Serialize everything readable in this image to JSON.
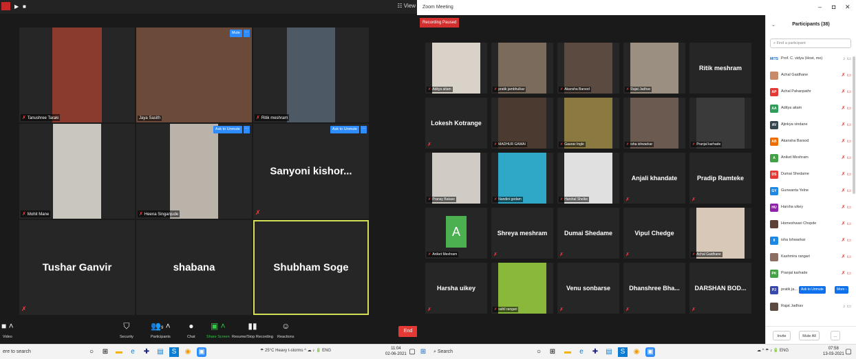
{
  "left_window": {
    "view_label": "View",
    "tiles": [
      {
        "name": "Tanushree Taraki",
        "kind": "video",
        "color": "#8a3b2e",
        "muted": true
      },
      {
        "name": "Jaya Sasith",
        "kind": "video",
        "color": "#6b4a3a",
        "muted": false,
        "mute_btn": "Mute"
      },
      {
        "name": "Ritik meshram",
        "kind": "video",
        "color": "#4d5a66",
        "muted": true
      },
      {
        "name": "Mohit Mane",
        "kind": "video",
        "color": "#c9c6c0",
        "muted": true
      },
      {
        "name": "Heena Singanjude",
        "kind": "video",
        "color": "#b9b3aa",
        "muted": true,
        "mute_btn": "Ask to Unmute"
      },
      {
        "name": "Sanyoni  kishor...",
        "kind": "name",
        "muted": true,
        "mute_btn": "Ask to Unmute"
      },
      {
        "name": "Tushar Ganvir",
        "kind": "name",
        "muted": true
      },
      {
        "name": "shabana",
        "kind": "name",
        "muted": false
      },
      {
        "name": "Shubham Soge",
        "kind": "name",
        "muted": false,
        "active": true
      }
    ],
    "toolbar": [
      {
        "label": "Video",
        "icon": "video-icon"
      },
      {
        "label": "Security",
        "icon": "shield-icon"
      },
      {
        "label": "Participants",
        "icon": "participants-icon",
        "count": "9"
      },
      {
        "label": "Chat",
        "icon": "chat-icon"
      },
      {
        "label": "Share Screen",
        "icon": "share-screen-icon"
      },
      {
        "label": "Resume/Stop Recording",
        "icon": "record-icon"
      },
      {
        "label": "Reactions",
        "icon": "reactions-icon"
      }
    ],
    "end_label": "End"
  },
  "right_window": {
    "title": "Zoom Meeting",
    "recording_status": "Recording Paused",
    "tiles": [
      {
        "name": "Aditya aitam",
        "kind": "video",
        "color": "#d8d2c8"
      },
      {
        "name": "pratik jambhulkar",
        "kind": "video",
        "color": "#7a6b5d"
      },
      {
        "name": "Akansha Barsod",
        "kind": "video",
        "color": "#5a4a40"
      },
      {
        "name": "Rajat Jadhav",
        "kind": "video",
        "color": "#9a8f80"
      },
      {
        "name": "Ritik meshram",
        "kind": "name"
      },
      {
        "name": "Lokesh Kotrange",
        "kind": "name"
      },
      {
        "name": "MADHUR GAWAI",
        "kind": "video",
        "color": "#4a3a30"
      },
      {
        "name": "Gaurav Ingle",
        "kind": "video",
        "color": "#8a7a40"
      },
      {
        "name": "isha ishwarkar",
        "kind": "video",
        "color": "#6a5a50"
      },
      {
        "name": "Pranjal karhade",
        "kind": "video",
        "color": "#3a3a3a"
      },
      {
        "name": "Pranay Batase",
        "kind": "video",
        "color": "#d0ccc5"
      },
      {
        "name": "Nandini gedam",
        "kind": "video",
        "color": "#2fa8c8"
      },
      {
        "name": "Harshal Shelke",
        "kind": "video",
        "color": "#e0e0e0"
      },
      {
        "name": "Anjali khandate",
        "kind": "name"
      },
      {
        "name": "Pradip Ramteke",
        "kind": "name"
      },
      {
        "name": "Aniket Meshram",
        "kind": "avatar",
        "letter": "A"
      },
      {
        "name": "Shreya meshram",
        "kind": "name"
      },
      {
        "name": "Dumai  Shedame",
        "kind": "name"
      },
      {
        "name": "Vipul Chedge",
        "kind": "name"
      },
      {
        "name": "Achal Gaidhane",
        "kind": "video",
        "color": "#d8c8b8"
      },
      {
        "name": "Harsha uikey",
        "kind": "name"
      },
      {
        "name": "sahil rangari",
        "kind": "video",
        "color": "#8ab83a"
      },
      {
        "name": "Venu sonbarse",
        "kind": "name"
      },
      {
        "name": "Dhanshree  Bha...",
        "kind": "name"
      },
      {
        "name": "DARSHAN  BOD...",
        "kind": "name"
      }
    ],
    "participants_panel": {
      "title": "Participants (38)",
      "search_placeholder": "Find a participant",
      "rows": [
        {
          "initials": "MITS",
          "name": "Prof. C. vidya (Host, me)",
          "color": "#ffffff",
          "text": "#1565c0",
          "muted": false
        },
        {
          "initials": "",
          "name": "Achal Gaidhane",
          "color": "#c98a6a",
          "muted": true
        },
        {
          "initials": "AP",
          "name": "Achal Pahanpathr",
          "color": "#e53935",
          "muted": true
        },
        {
          "initials": "AA",
          "name": "Aditya aitam",
          "color": "#2e9d5a",
          "muted": true
        },
        {
          "initials": "AV",
          "name": "Ajinkya vindane",
          "color": "#37474f",
          "muted": true
        },
        {
          "initials": "AB",
          "name": "Akansha Barsod",
          "color": "#ef6c00",
          "muted": true
        },
        {
          "initials": "A",
          "name": "Aniket Meshram",
          "color": "#43a047",
          "muted": true
        },
        {
          "initials": "DS",
          "name": "Dumai  Shedame",
          "color": "#e53935",
          "muted": true
        },
        {
          "initials": "GY",
          "name": "Gunwanta Yelne",
          "color": "#1e88e5",
          "muted": true
        },
        {
          "initials": "HU",
          "name": "Harsha uikey",
          "color": "#8e24aa",
          "muted": true
        },
        {
          "initials": "",
          "name": "Homeshwari Chopde",
          "color": "#5d4037",
          "muted": true
        },
        {
          "initials": "II",
          "name": "isha Ishwarkar",
          "color": "#1e88e5",
          "muted": true
        },
        {
          "initials": "",
          "name": "Kashmira rangari",
          "color": "#8d6e63",
          "muted": true
        },
        {
          "initials": "PK",
          "name": "Pranjal karhade",
          "color": "#43a047",
          "muted": true
        },
        {
          "initials": "PJ",
          "name": "pratik ja...",
          "color": "#3949ab",
          "muted": true,
          "ask_btn": "Ask to Unmute",
          "more_btn": "More ›"
        },
        {
          "initials": "",
          "name": "Rajat Jadhav",
          "color": "#5a4a40",
          "muted": false
        }
      ],
      "invite_label": "Invite",
      "mute_all_label": "Mute All",
      "more_label": "..."
    }
  },
  "taskbar": {
    "search_left": "ere to search",
    "search_right": "Search",
    "weather_left": "25°C Heavy t-storms",
    "lang": "ENG",
    "time_left": "11:04",
    "date_left": "02-06-2021",
    "time_right": "07:58",
    "date_right": "13-03-2021"
  }
}
